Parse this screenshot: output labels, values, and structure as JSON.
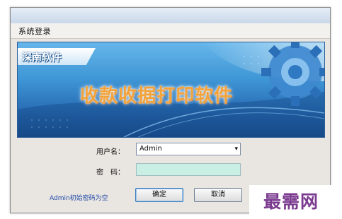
{
  "window": {
    "title": "系统登录"
  },
  "banner": {
    "brand": "深南软件",
    "title": "收款收据打印软件"
  },
  "form": {
    "username_label": "用户名：",
    "username_value": "Admin",
    "password_label": "密　码：",
    "password_value": "",
    "hint": "Admin初始密码为空"
  },
  "buttons": {
    "ok_label": "确定",
    "cancel_label": "取消"
  },
  "watermark": {
    "text": "最需网"
  },
  "colors": {
    "banner_top": "#66b6ea",
    "banner_bottom": "#1c4f8f",
    "title_orange": "#f2a23a",
    "password_field": "#c9efe4",
    "hint_blue": "#1f47a8",
    "watermark_purple": "#7a3a8f"
  },
  "icons": [
    "gear-icon",
    "chevron-down-icon"
  ]
}
